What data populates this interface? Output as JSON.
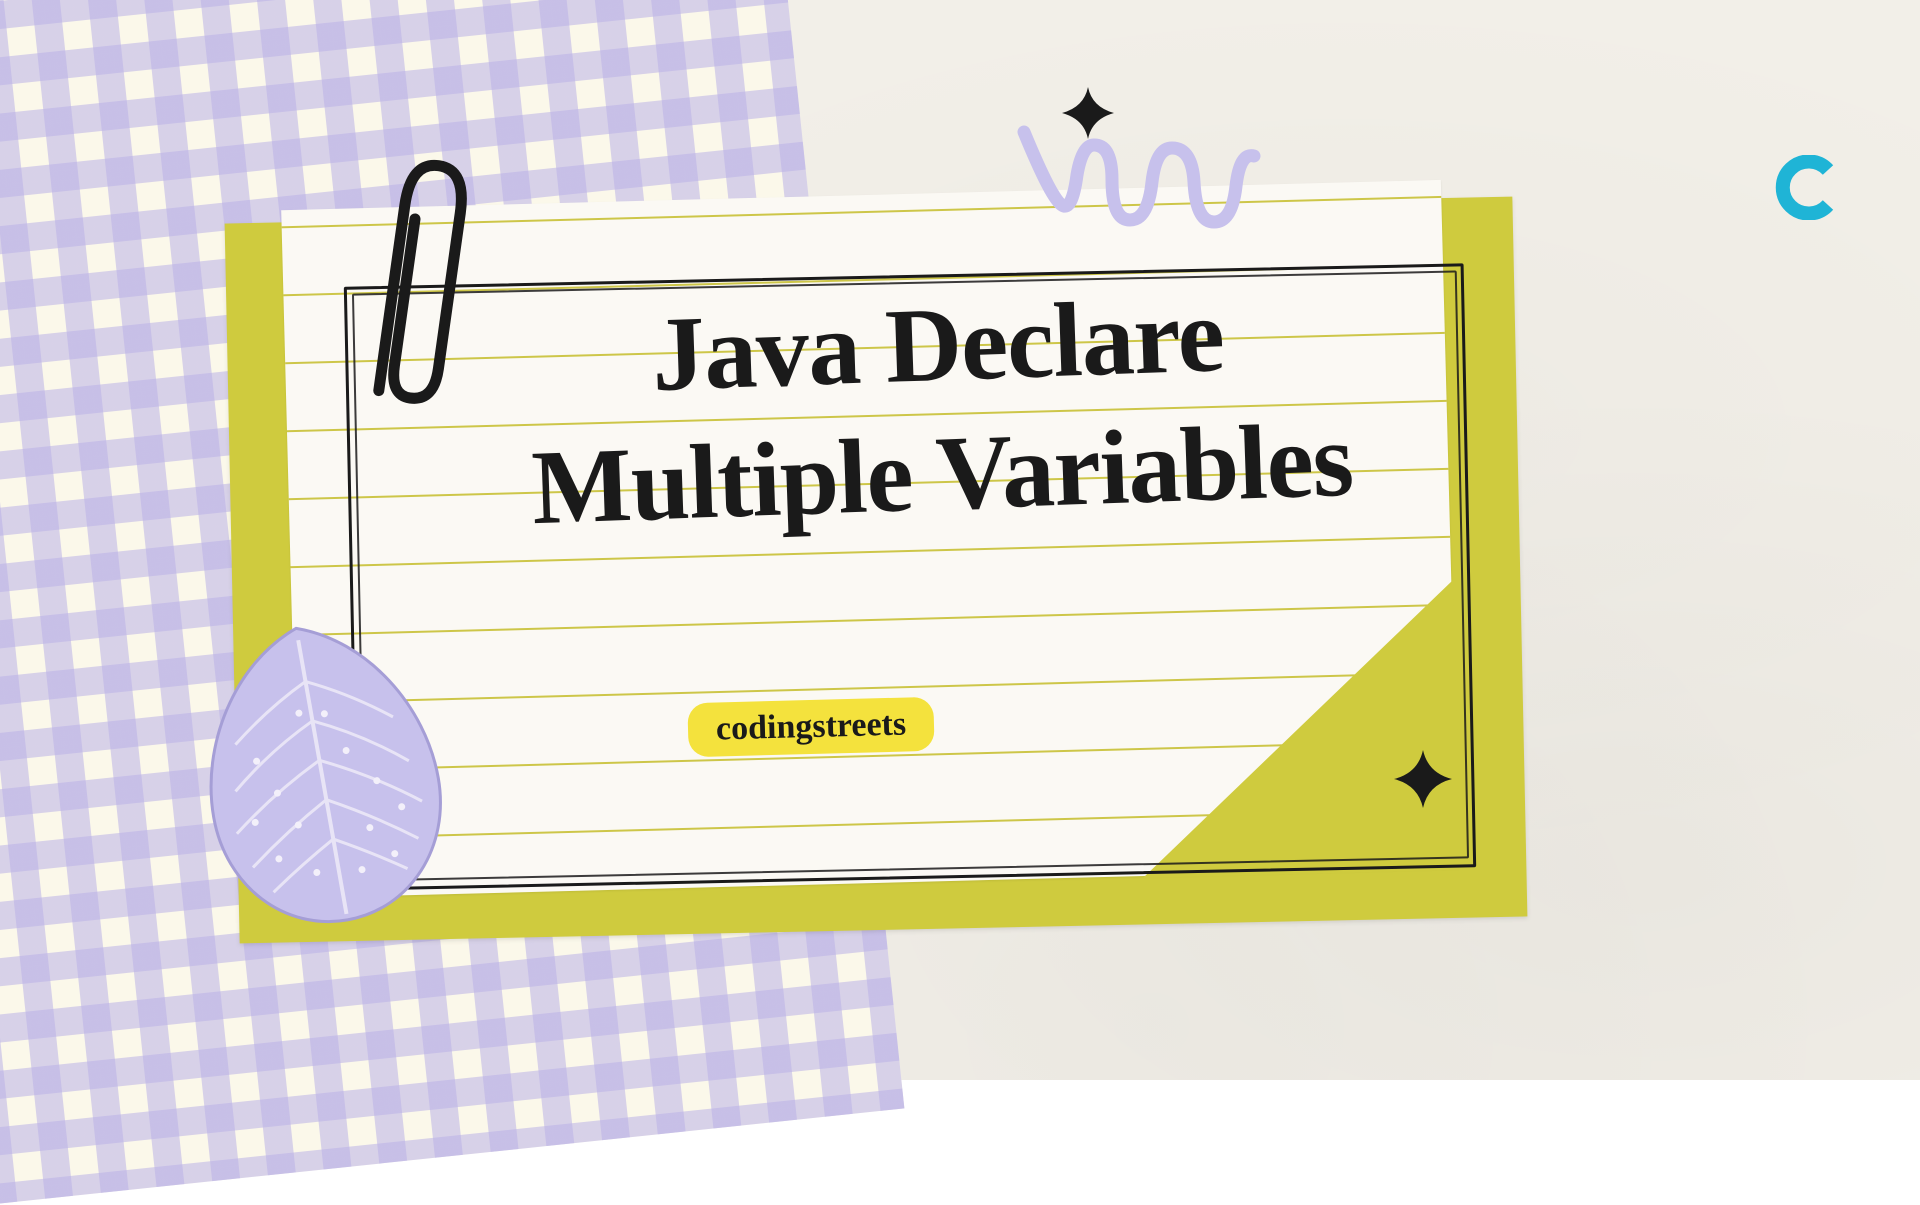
{
  "title_line1": "Java Declare",
  "title_line2": "Multiple Variables",
  "subtitle": "codingstreets",
  "colors": {
    "gingham_primary": "#bab1e6",
    "gingham_bg": "#fbf8ea",
    "yellow_card": "#cfcb3e",
    "pill_bg": "#f4e23d",
    "text": "#1a1a1a",
    "logo_teal": "#1fb4d6",
    "leaf_fill": "#c7c1ec",
    "leaf_stroke": "#a59ed6",
    "bg": "#f2efe8"
  }
}
